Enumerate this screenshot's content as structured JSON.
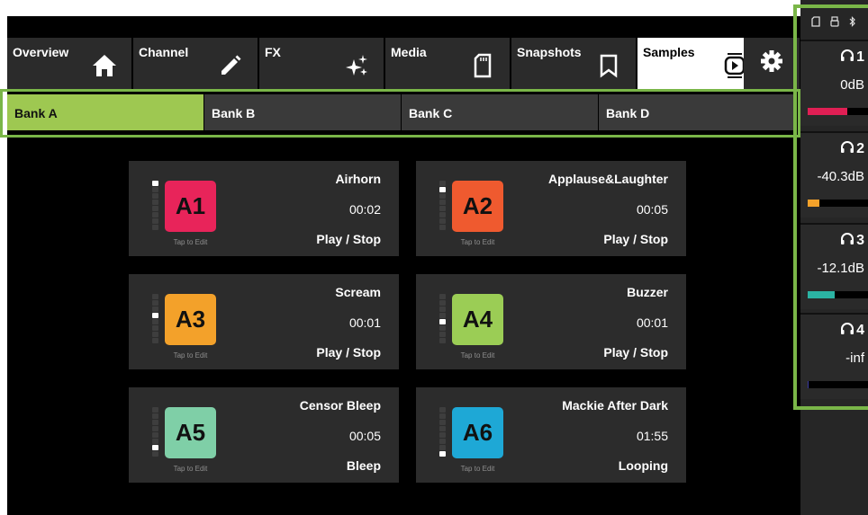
{
  "tabs": [
    {
      "label": "Overview",
      "icon": "home-icon"
    },
    {
      "label": "Channel",
      "icon": "pencil-icon"
    },
    {
      "label": "FX",
      "icon": "sparkle-icon"
    },
    {
      "label": "Media",
      "icon": "sd-card-icon"
    },
    {
      "label": "Snapshots",
      "icon": "bookmark-icon"
    },
    {
      "label": "Samples",
      "icon": "sample-player-icon",
      "active": true
    }
  ],
  "settings_icon": "gear-icon",
  "banks": [
    {
      "label": "Bank A",
      "active": true
    },
    {
      "label": "Bank B"
    },
    {
      "label": "Bank C"
    },
    {
      "label": "Bank D"
    }
  ],
  "tap_label": "Tap to Edit",
  "samples": [
    {
      "pad": "A1",
      "name": "Airhorn",
      "time": "00:02",
      "action": "Play / Stop",
      "color": "#e8245a",
      "level_segment": 1
    },
    {
      "pad": "A2",
      "name": "Applause&Laughter",
      "time": "00:05",
      "action": "Play / Stop",
      "color": "#ef5a2f",
      "level_segment": 2
    },
    {
      "pad": "A3",
      "name": "Scream",
      "time": "00:01",
      "action": "Play / Stop",
      "color": "#f3a12a",
      "level_segment": 4
    },
    {
      "pad": "A4",
      "name": "Buzzer",
      "time": "00:01",
      "action": "Play / Stop",
      "color": "#9bcd55",
      "level_segment": 5
    },
    {
      "pad": "A5",
      "name": "Censor Bleep",
      "time": "00:05",
      "action": "Bleep",
      "color": "#7fcfa7",
      "level_segment": 7
    },
    {
      "pad": "A6",
      "name": "Mackie After Dark",
      "time": "01:55",
      "action": "Looping",
      "color": "#1ea8d6",
      "level_segment": 8
    }
  ],
  "status_icons": [
    "sd-card-icon",
    "usb-icon",
    "bluetooth-icon"
  ],
  "headphones": [
    {
      "num": "1",
      "level": "0dB",
      "fill": 0.65,
      "color": "#e01f54"
    },
    {
      "num": "2",
      "level": "-40.3dB",
      "fill": 0.2,
      "color": "#f3a12a"
    },
    {
      "num": "3",
      "level": "-12.1dB",
      "fill": 0.45,
      "color": "#2bb3a3"
    },
    {
      "num": "4",
      "level": "-inf",
      "fill": 0.02,
      "color": "#3a3aa0"
    }
  ],
  "colors": {
    "accent": "#7ab648",
    "active_bank": "#9ec851"
  }
}
